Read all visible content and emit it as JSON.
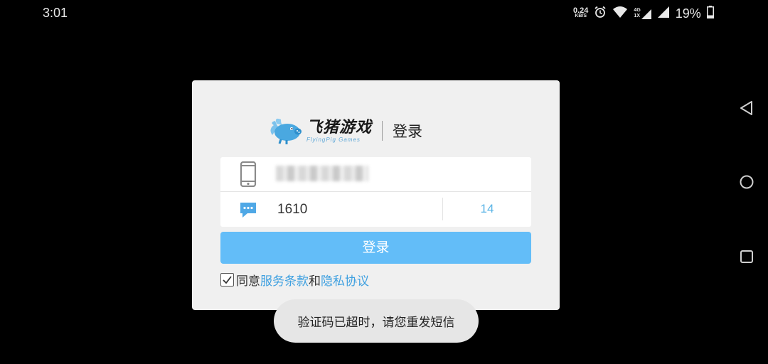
{
  "status_bar": {
    "time": "3:01",
    "net_speed_value": "0.24",
    "net_speed_unit": "KB/S",
    "network_type_top": "4G",
    "network_type_bottom": "1X",
    "battery_percent": "19%",
    "icons": [
      "alarm-icon",
      "wifi-icon",
      "signal-icon",
      "battery-icon"
    ]
  },
  "nav_bar": {
    "icons": [
      "back-icon",
      "home-icon",
      "recents-icon"
    ]
  },
  "dialog": {
    "brand_name": "飞猪游戏",
    "brand_english": "FlyingPig Games",
    "title": "登录",
    "phone_icon": "phone-icon",
    "message_icon": "message-icon",
    "verification_code": "1610",
    "countdown": "14",
    "login_button": "登录",
    "agreement": {
      "checked": true,
      "prefix": "同意",
      "terms_link": "服务条款",
      "conjunction": "和",
      "privacy_link": "隐私协议"
    }
  },
  "toast": {
    "message": "验证码已超时，请您重发短信"
  },
  "colors": {
    "accent": "#63bdf8",
    "link": "#3ea0e0",
    "countdown": "#5ab4e6",
    "dialog_bg": "#f0f0f0"
  }
}
